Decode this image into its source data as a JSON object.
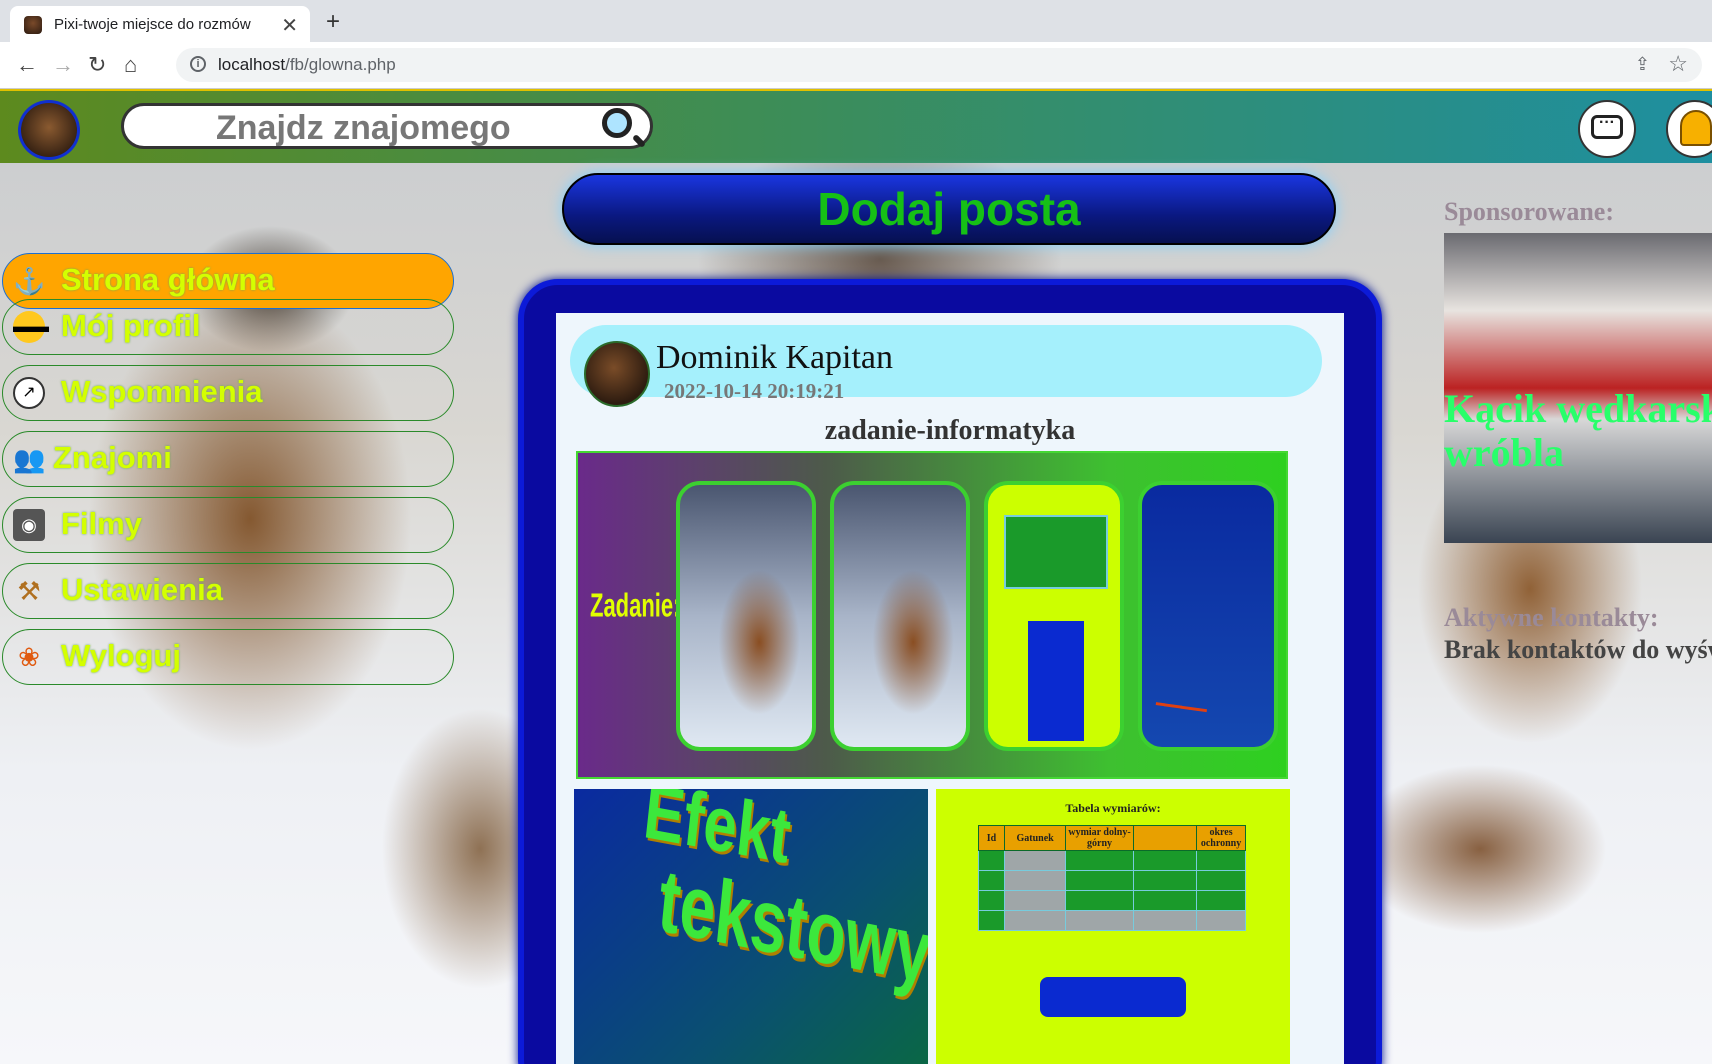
{
  "browser": {
    "tab_title": "Pixi-twoje miejsce do rozmów",
    "url_host": "localhost",
    "url_path": "/fb/glowna.php"
  },
  "header": {
    "search_placeholder": "Znajdz znajomego"
  },
  "sidebar": {
    "items": [
      {
        "label": "Strona główna",
        "icon": "anchor-icon",
        "active": true
      },
      {
        "label": "Mój profil",
        "icon": "sunglasses-icon"
      },
      {
        "label": "Wspomnienia",
        "icon": "clock-icon"
      },
      {
        "label": "Znajomi",
        "icon": "friends-icon"
      },
      {
        "label": "Filmy",
        "icon": "camera-icon"
      },
      {
        "label": "Ustawienia",
        "icon": "hammer-icon"
      },
      {
        "label": "Wyloguj",
        "icon": "paw-icon"
      }
    ]
  },
  "main": {
    "add_post_label": "Dodaj posta",
    "post": {
      "author": "Dominik Kapitan",
      "date": "2022-10-14 20:19:21",
      "title": "zadanie-informatyka",
      "image1_caption": "Zadanie:",
      "image2_text_line1": "Efekt",
      "image2_text_line2": "tekstowy",
      "table_caption": "Tabela wymiarów:",
      "table_headers": [
        "Id",
        "Gatunek",
        "wymiar dolny-górny",
        "",
        "okres ochronny"
      ]
    }
  },
  "right": {
    "sponsored_label": "Sponsorowane:",
    "ad_title_line1": "Kącik wędkarski",
    "ad_title_line2": "wróbla",
    "contacts_label": "Aktywne kontakty:",
    "contacts_empty": "Brak kontaktów do wyświetlenia"
  },
  "colors": {
    "active_menu": "#ffa500",
    "menu_text": "#d4ff00",
    "add_post_text": "#16c016",
    "post_header_bg": "#a5f0fc"
  }
}
